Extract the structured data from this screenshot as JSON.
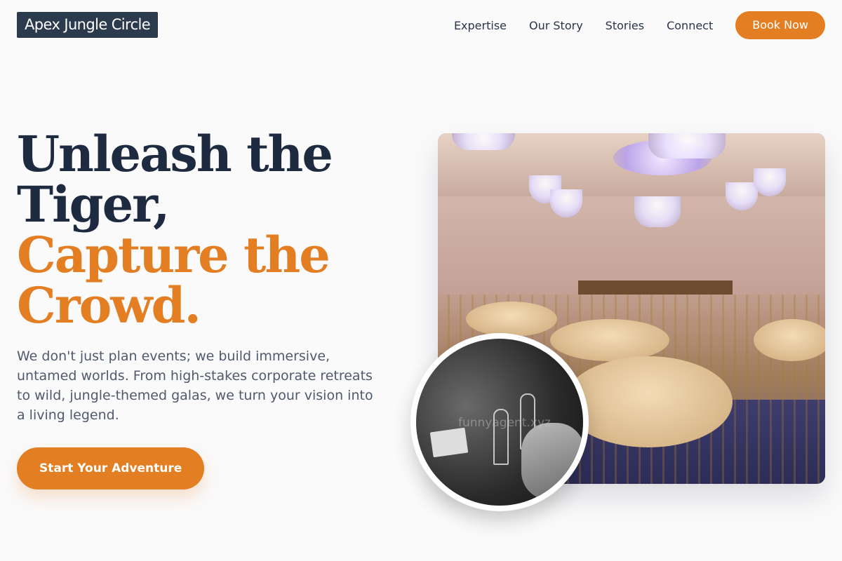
{
  "brand": {
    "logo_text": "Apex Jungle Circle"
  },
  "nav": {
    "links": [
      {
        "label": "Expertise"
      },
      {
        "label": "Our Story"
      },
      {
        "label": "Stories"
      },
      {
        "label": "Connect"
      }
    ],
    "book_button": "Book Now"
  },
  "hero": {
    "title_line1": "Unleash the",
    "title_line2": "Tiger,",
    "title_line3": "Capture the",
    "title_line4": "Crowd.",
    "description": "We don't just plan events; we build immersive, untamed worlds. From high-stakes corporate retreats to wild, jungle-themed galas, we turn your vision into a living legend.",
    "cta_label": "Start Your Adventure",
    "inset_watermark": "funnyagent.xyz"
  },
  "colors": {
    "accent": "#e37f22",
    "navy": "#1d2a40",
    "logo_bg": "#2c3a4e"
  }
}
